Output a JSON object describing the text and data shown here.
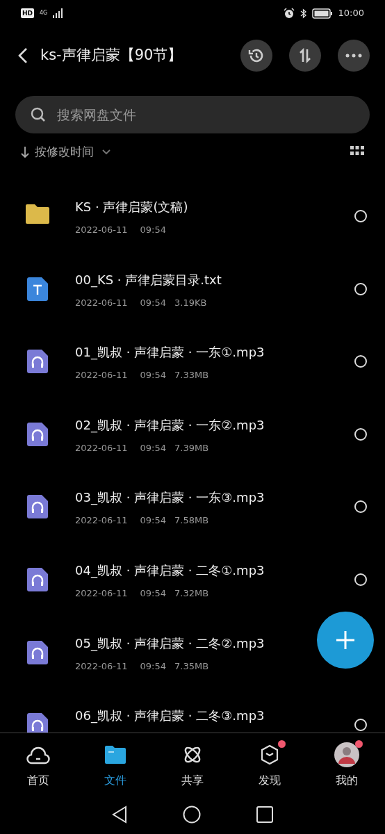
{
  "status_bar": {
    "hd": "HD",
    "network": "4G",
    "time": "10:00"
  },
  "header": {
    "title": "ks-声律启蒙【90节】"
  },
  "search": {
    "placeholder": "搜索网盘文件"
  },
  "sort": {
    "label": "按修改时间"
  },
  "files": [
    {
      "kind": "folder",
      "name": "KS · 声律启蒙(文稿)",
      "date": "2022-06-11",
      "time": "09:54",
      "selected": false
    },
    {
      "kind": "text",
      "name": "00_KS · 声律启蒙目录.txt",
      "date": "2022-06-11",
      "time": "09:54",
      "size": "3.19KB",
      "selected": false
    },
    {
      "kind": "audio",
      "name": "01_凯叔 · 声律启蒙 · 一东①.mp3",
      "date": "2022-06-11",
      "time": "09:54",
      "size": "7.33MB",
      "selected": false
    },
    {
      "kind": "audio",
      "name": "02_凯叔 · 声律启蒙 · 一东②.mp3",
      "date": "2022-06-11",
      "time": "09:54",
      "size": "7.39MB",
      "selected": false
    },
    {
      "kind": "audio",
      "name": "03_凯叔 · 声律启蒙 · 一东③.mp3",
      "date": "2022-06-11",
      "time": "09:54",
      "size": "7.58MB",
      "selected": false
    },
    {
      "kind": "audio",
      "name": "04_凯叔 · 声律启蒙 · 二冬①.mp3",
      "date": "2022-06-11",
      "time": "09:54",
      "size": "7.32MB",
      "selected": false
    },
    {
      "kind": "audio",
      "name": "05_凯叔 · 声律启蒙 · 二冬②.mp3",
      "date": "2022-06-11",
      "time": "09:54",
      "size": "7.35MB"
    },
    {
      "kind": "audio",
      "name": "06_凯叔 · 声律启蒙 · 二冬③.mp3",
      "selected": false
    }
  ],
  "tabs": [
    {
      "kind": "home",
      "label": "首页",
      "selected": false,
      "badge": false
    },
    {
      "kind": "files",
      "label": "文件",
      "selected": true,
      "badge": false
    },
    {
      "kind": "share",
      "label": "共享",
      "selected": false,
      "badge": false
    },
    {
      "kind": "discover",
      "label": "发现",
      "selected": false,
      "badge": true
    },
    {
      "kind": "me",
      "label": "我的",
      "selected": false,
      "badge": true
    }
  ]
}
